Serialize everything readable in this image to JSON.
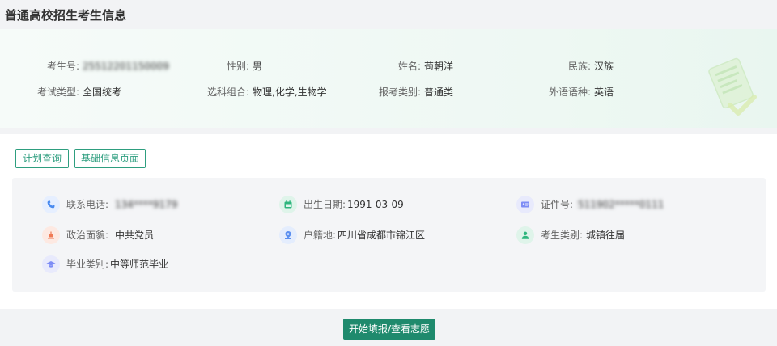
{
  "page": {
    "title": "普通高校招生考生信息"
  },
  "summary": {
    "candidate_no": {
      "label": "考生号:",
      "value": "25512201150009"
    },
    "gender": {
      "label": "性别:",
      "value": "男"
    },
    "name": {
      "label": "姓名:",
      "value": "苟朝洋"
    },
    "ethnicity": {
      "label": "民族:",
      "value": "汉族"
    },
    "exam_type": {
      "label": "考试类型:",
      "value": "全国统考"
    },
    "subjects": {
      "label": "选科组合:",
      "value": "物理,化学,生物学"
    },
    "apply_category": {
      "label": "报考类别:",
      "value": "普通类"
    },
    "foreign_language": {
      "label": "外语语种:",
      "value": "英语"
    }
  },
  "actions": {
    "plan_query": "计划查询",
    "basic_info": "基础信息页面",
    "start": "开始填报/查看志愿"
  },
  "details": {
    "phone": {
      "label": "联系电话:",
      "value": "134****9179",
      "icon": "phone-icon",
      "color": "#4a8bf0"
    },
    "birth_date": {
      "label": "出生日期:",
      "value": "1991-03-09",
      "icon": "calendar-icon",
      "color": "#2eb67d"
    },
    "id_no": {
      "label": "证件号:",
      "value": "511902*****0111",
      "icon": "id-card-icon",
      "color": "#7d8cf5"
    },
    "political": {
      "label": "政治面貌:",
      "value": "中共党员",
      "icon": "party-icon",
      "color": "#f07a55"
    },
    "hukou": {
      "label": "户籍地:",
      "value": "四川省成都市锦江区",
      "icon": "location-icon",
      "color": "#5b8ff0"
    },
    "candidate_type": {
      "label": "考生类别:",
      "value": "城镇往届",
      "icon": "person-icon",
      "color": "#2eb67d"
    },
    "graduation_type": {
      "label": "毕业类别:",
      "value": "中等师范毕业",
      "icon": "graduation-cap-icon",
      "color": "#7d8cf5"
    }
  }
}
